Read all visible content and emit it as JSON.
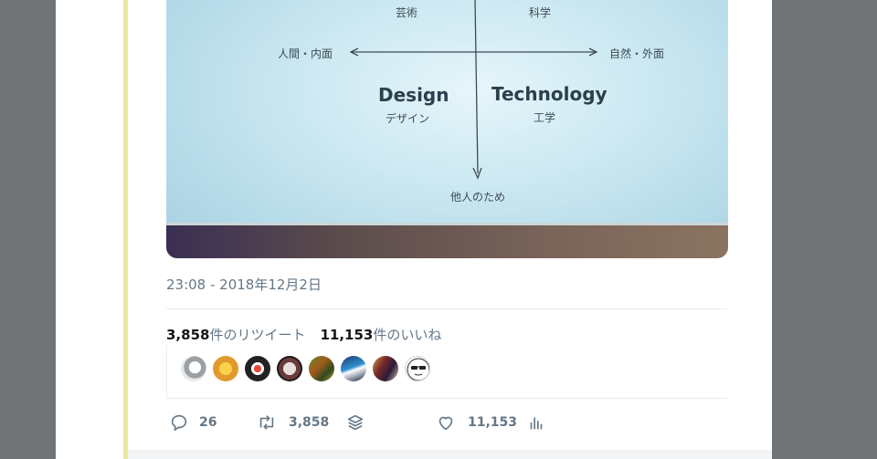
{
  "photo": {
    "top_left": "芸術",
    "top_right": "科学",
    "left": "人間・内面",
    "right": "自然・外面",
    "design_en": "Design",
    "design_jp": "デザイン",
    "tech_en": "Technology",
    "tech_jp": "工学",
    "bottom": "他人のため"
  },
  "tweet": {
    "timestamp": "23:08 - 2018年12月2日",
    "retweets_count": "3,858",
    "retweets_label": "件のリツイート",
    "likes_count": "11,153",
    "likes_label": "件のいいね"
  },
  "actions": {
    "reply_count": "26",
    "retweet_count": "3,858",
    "like_count": "11,153"
  },
  "colors": {
    "background": "#707477",
    "card": "#ffffff",
    "accent": "#e8eaa0",
    "muted_text": "#657786",
    "strong_text": "#14171a"
  }
}
